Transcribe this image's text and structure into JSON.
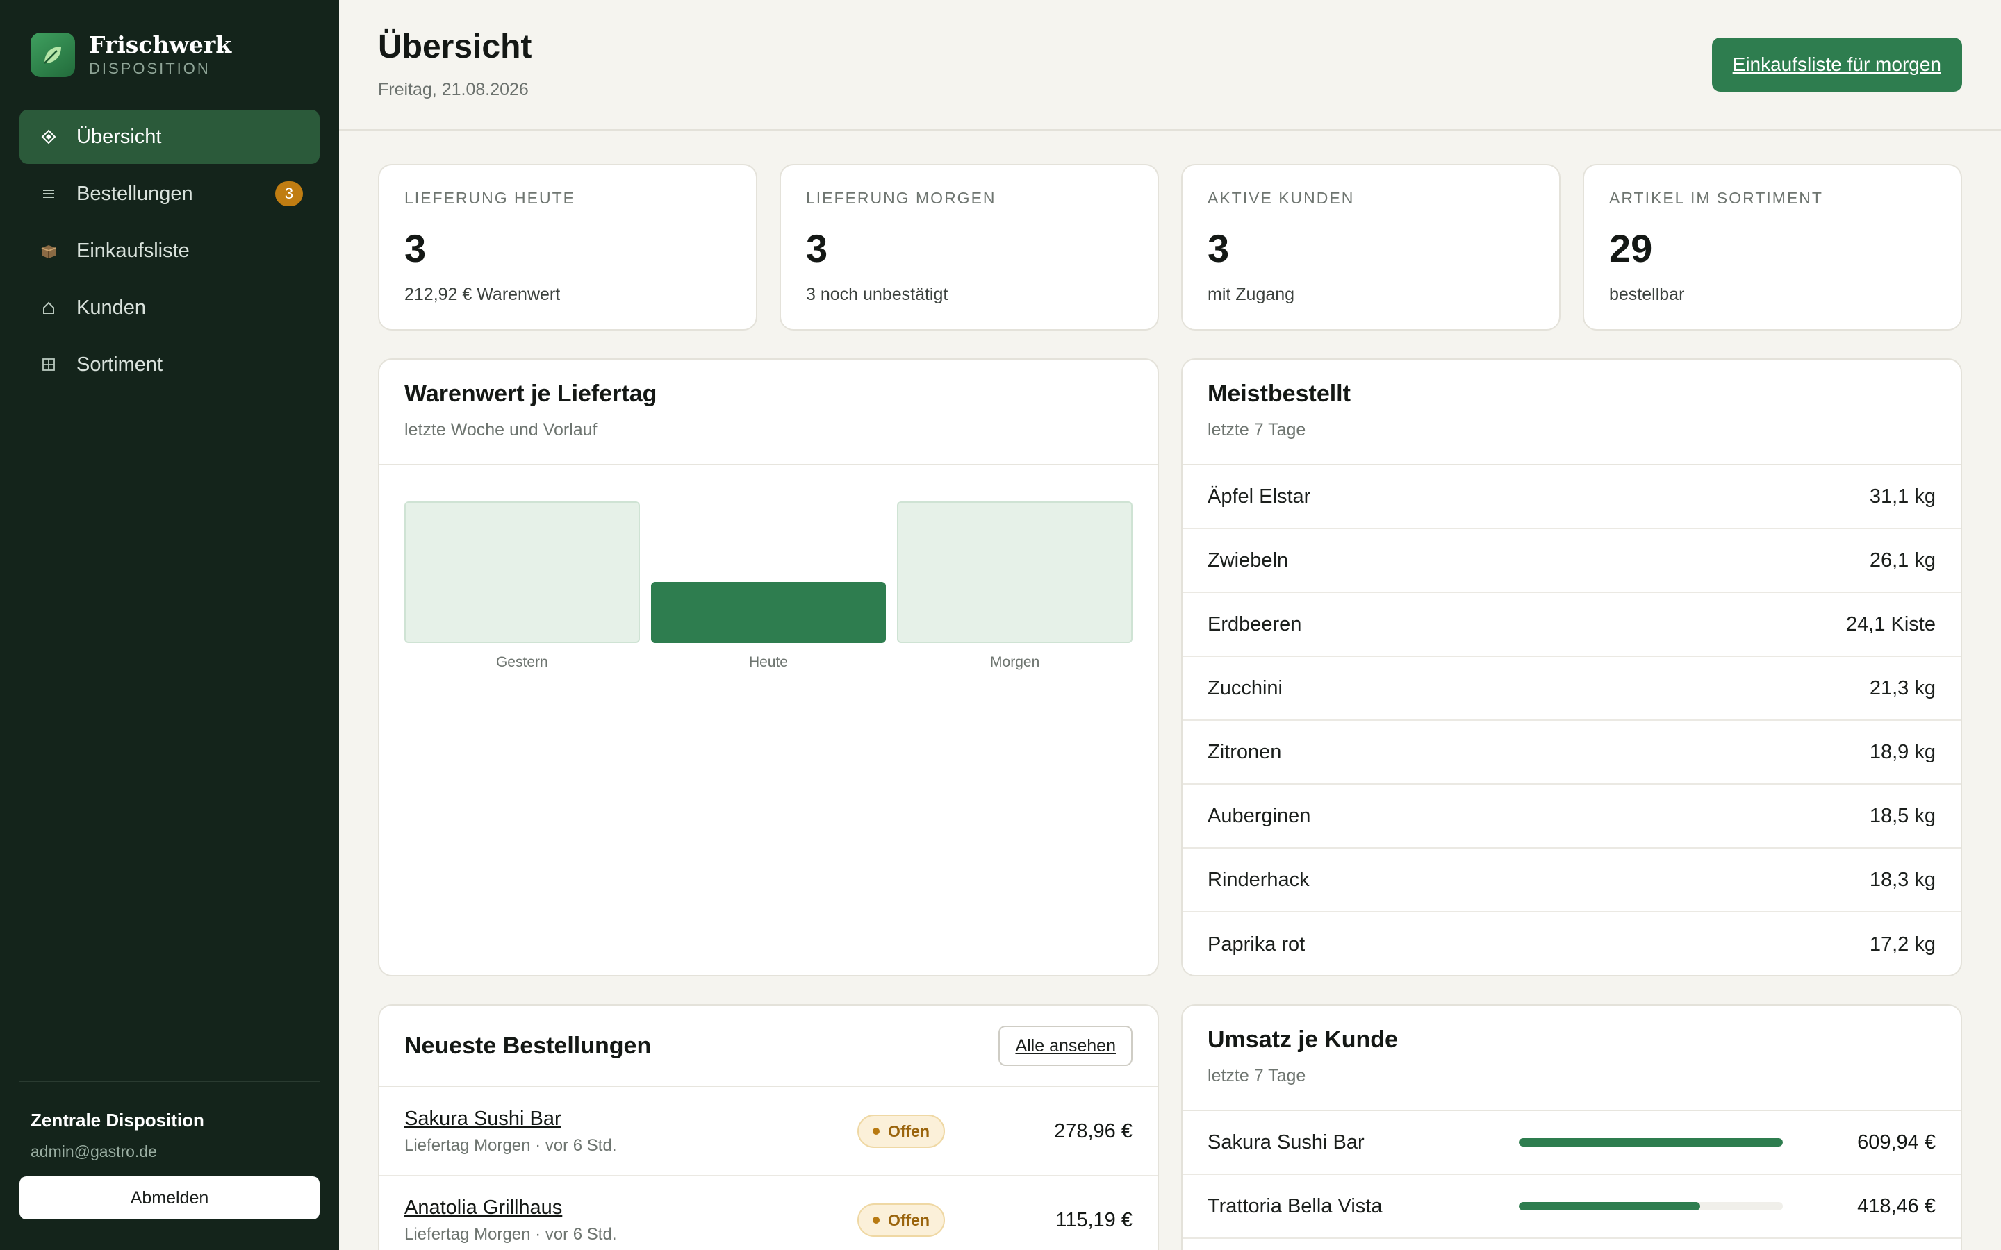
{
  "brand": {
    "name": "Frischwerk",
    "subtitle": "DISPOSITION"
  },
  "nav": {
    "items": [
      {
        "label": "Übersicht",
        "icon": "diamond-icon",
        "active": true
      },
      {
        "label": "Bestellungen",
        "icon": "list-icon",
        "badge": "3"
      },
      {
        "label": "Einkaufsliste",
        "icon": "box-icon"
      },
      {
        "label": "Kunden",
        "icon": "home-icon"
      },
      {
        "label": "Sortiment",
        "icon": "grid-icon"
      }
    ]
  },
  "user": {
    "name": "Zentrale Disposition",
    "email": "admin@gastro.de",
    "logout_label": "Abmelden"
  },
  "header": {
    "title": "Übersicht",
    "date": "Freitag, 21.08.2026",
    "primary_action": "Einkaufsliste für morgen"
  },
  "stats": [
    {
      "label": "LIEFERUNG HEUTE",
      "value": "3",
      "sub": "212,92 € Warenwert"
    },
    {
      "label": "LIEFERUNG MORGEN",
      "value": "3",
      "sub": "3 noch unbestätigt"
    },
    {
      "label": "AKTIVE KUNDEN",
      "value": "3",
      "sub": "mit Zugang"
    },
    {
      "label": "ARTIKEL IM SORTIMENT",
      "value": "29",
      "sub": "bestellbar"
    }
  ],
  "warenwert": {
    "title": "Warenwert je Liefertag",
    "subtitle": "letzte Woche und Vorlauf",
    "bars": [
      {
        "label": "Gestern",
        "relative": 1.0,
        "highlight": false
      },
      {
        "label": "Heute",
        "relative": 0.43,
        "highlight": true
      },
      {
        "label": "Morgen",
        "relative": 1.0,
        "highlight": false
      }
    ]
  },
  "meistbestellt": {
    "title": "Meistbestellt",
    "subtitle": "letzte 7 Tage",
    "items": [
      {
        "name": "Äpfel Elstar",
        "qty": "31,1 kg"
      },
      {
        "name": "Zwiebeln",
        "qty": "26,1 kg"
      },
      {
        "name": "Erdbeeren",
        "qty": "24,1 Kiste"
      },
      {
        "name": "Zucchini",
        "qty": "21,3 kg"
      },
      {
        "name": "Zitronen",
        "qty": "18,9 kg"
      },
      {
        "name": "Auberginen",
        "qty": "18,5 kg"
      },
      {
        "name": "Rinderhack",
        "qty": "18,3 kg"
      },
      {
        "name": "Paprika rot",
        "qty": "17,2 kg"
      }
    ]
  },
  "orders": {
    "title": "Neueste Bestellungen",
    "view_all": "Alle ansehen",
    "rows": [
      {
        "customer": "Sakura Sushi Bar",
        "meta": "Liefertag Morgen · vor 6 Std.",
        "status": "Offen",
        "amount": "278,96 €"
      },
      {
        "customer": "Anatolia Grillhaus",
        "meta": "Liefertag Morgen · vor 6 Std.",
        "status": "Offen",
        "amount": "115,19 €"
      }
    ]
  },
  "umsatz": {
    "title": "Umsatz je Kunde",
    "subtitle": "letzte 7 Tage",
    "rows": [
      {
        "name": "Sakura Sushi Bar",
        "amount": "609,94 €",
        "share": 1.0
      },
      {
        "name": "Trattoria Bella Vista",
        "amount": "418,46 €",
        "share": 0.686
      }
    ]
  },
  "colors": {
    "accent": "#2e7d4f",
    "sidebar": "#14241b",
    "badge": "#c07d12",
    "status_open": "#9a640c"
  }
}
